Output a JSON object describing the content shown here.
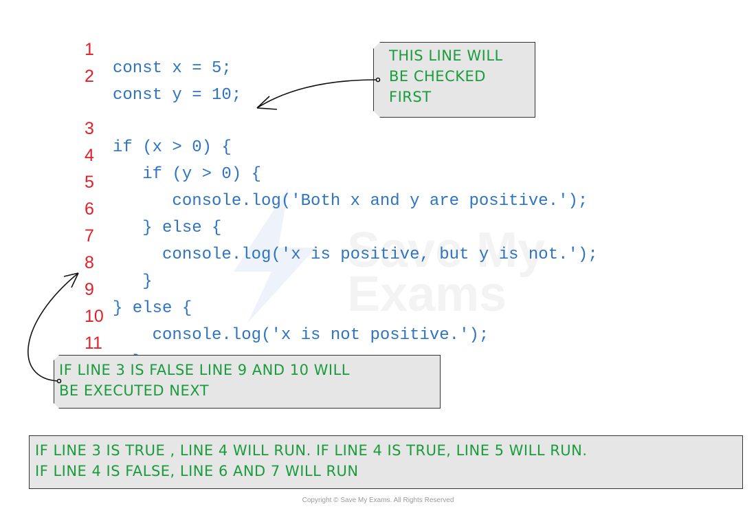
{
  "code_lines": [
    {
      "number": "1",
      "code": "const x = 5;"
    },
    {
      "number": "2",
      "code": "const y = 10;"
    },
    {
      "number": "3",
      "code": "if (x > 0) {"
    },
    {
      "number": "4",
      "code": "   if (y > 0) {"
    },
    {
      "number": "5",
      "code": "      console.log('Both x and y are positive.');"
    },
    {
      "number": "6",
      "code": "   } else {"
    },
    {
      "number": "7",
      "code": "     console.log('x is positive, but y is not.');"
    },
    {
      "number": "8",
      "code": "   }"
    },
    {
      "number": "9",
      "code": "} else {"
    },
    {
      "number": "10",
      "code": "    console.log('x is not positive.');"
    },
    {
      "number": "11",
      "code": "  }"
    }
  ],
  "notes": {
    "checked_first": [
      "THIS LINE WILL",
      "BE CHECKED",
      "FIRST"
    ],
    "false_branch": [
      "IF LINE 3 IS FALSE LINE 9 AND 10 WILL",
      "BE EXECUTED NEXT"
    ],
    "true_branch": [
      "IF LINE 3 IS TRUE , LINE 4 WILL RUN. IF LINE 4 IS TRUE, LINE 5 WILL RUN.",
      "IF LINE 4 IS FALSE, LINE 6 AND 7 WILL RUN"
    ]
  },
  "watermark": {
    "line1": "Save My",
    "line2": "Exams"
  },
  "copyright": "Copyright © Save My Exams. All Rights Reserved",
  "colors": {
    "line_number": "#e3202a",
    "code": "#2f74c0",
    "note_text": "#1a9b3c",
    "note_bg": "#e6e6e6"
  }
}
